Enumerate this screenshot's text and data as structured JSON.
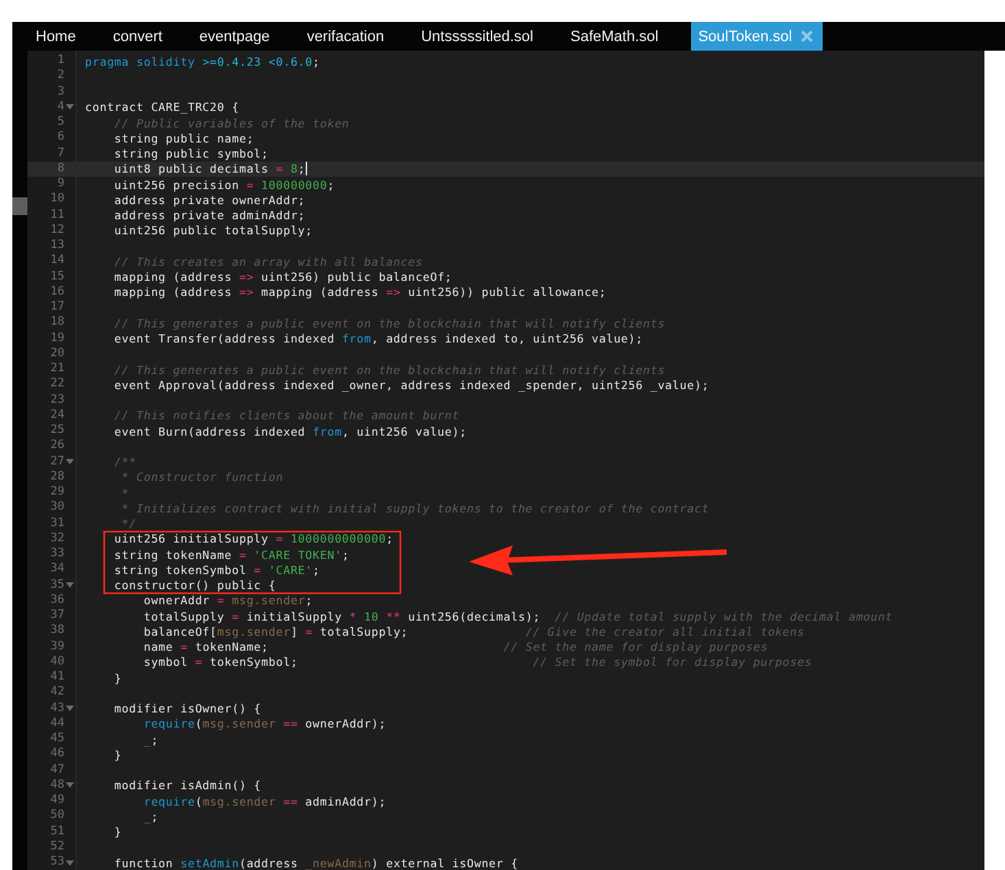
{
  "tabs": [
    {
      "label": "Home",
      "selected": false,
      "closable": false
    },
    {
      "label": "convert",
      "selected": false,
      "closable": false
    },
    {
      "label": "eventpage",
      "selected": false,
      "closable": false
    },
    {
      "label": "verifacation",
      "selected": false,
      "closable": false
    },
    {
      "label": "Untsssssitled.sol",
      "selected": false,
      "closable": false
    },
    {
      "label": "SafeMath.sol",
      "selected": false,
      "closable": false
    },
    {
      "label": "SoulToken.sol",
      "selected": true,
      "closable": true
    }
  ],
  "editor": {
    "lines": [
      {
        "number": "1",
        "active": false,
        "foldable": false,
        "tokens": [
          {
            "kind": "keyword",
            "text": "pragma solidity "
          },
          {
            "kind": "version",
            "text": ">=0.4.23 <0.6.0"
          },
          {
            "kind": "plain",
            "text": ";"
          }
        ]
      },
      {
        "number": "2",
        "active": false,
        "foldable": false
      },
      {
        "number": "3",
        "active": false,
        "foldable": false
      },
      {
        "number": "4",
        "active": false,
        "foldable": true,
        "tokens": [
          {
            "kind": "plain",
            "text": "contract CARE_TRC20 {"
          }
        ]
      },
      {
        "number": "5",
        "active": false,
        "foldable": false,
        "tokens": [
          {
            "kind": "comment",
            "text": "    // Public variables of the token"
          }
        ]
      },
      {
        "number": "6",
        "active": false,
        "foldable": false,
        "tokens": [
          {
            "kind": "plain",
            "text": "    string public name;"
          }
        ]
      },
      {
        "number": "7",
        "active": false,
        "foldable": false,
        "tokens": [
          {
            "kind": "plain",
            "text": "    string public symbol;"
          }
        ]
      },
      {
        "number": "8",
        "active": true,
        "foldable": false,
        "tokens": [
          {
            "kind": "plain",
            "text": "    uint8 public decimals "
          },
          {
            "kind": "operator",
            "text": "="
          },
          {
            "kind": "number",
            "text": " 8"
          },
          {
            "kind": "plain",
            "text": ";"
          }
        ]
      },
      {
        "number": "9",
        "active": false,
        "foldable": false,
        "tokens": [
          {
            "kind": "plain",
            "text": "    uint256 precision "
          },
          {
            "kind": "operator",
            "text": "="
          },
          {
            "kind": "number",
            "text": " 100000000"
          },
          {
            "kind": "plain",
            "text": ";"
          }
        ]
      },
      {
        "number": "10",
        "active": false,
        "foldable": false,
        "tokens": [
          {
            "kind": "plain",
            "text": "    address private ownerAddr;"
          }
        ]
      },
      {
        "number": "11",
        "active": false,
        "foldable": false,
        "tokens": [
          {
            "kind": "plain",
            "text": "    address private adminAddr;"
          }
        ]
      },
      {
        "number": "12",
        "active": false,
        "foldable": false,
        "tokens": [
          {
            "kind": "plain",
            "text": "    uint256 public totalSupply;"
          }
        ]
      },
      {
        "number": "13",
        "active": false,
        "foldable": false
      },
      {
        "number": "14",
        "active": false,
        "foldable": false,
        "tokens": [
          {
            "kind": "comment",
            "text": "    // This creates an array with all balances"
          }
        ]
      },
      {
        "number": "15",
        "active": false,
        "foldable": false,
        "tokens": [
          {
            "kind": "plain",
            "text": "    mapping (address "
          },
          {
            "kind": "operator",
            "text": "=>"
          },
          {
            "kind": "plain",
            "text": " uint256) public balanceOf;"
          }
        ]
      },
      {
        "number": "16",
        "active": false,
        "foldable": false,
        "tokens": [
          {
            "kind": "plain",
            "text": "    mapping (address "
          },
          {
            "kind": "operator",
            "text": "=>"
          },
          {
            "kind": "plain",
            "text": " mapping (address "
          },
          {
            "kind": "operator",
            "text": "=>"
          },
          {
            "kind": "plain",
            "text": " uint256)) public allowance;"
          }
        ]
      },
      {
        "number": "17",
        "active": false,
        "foldable": false
      },
      {
        "number": "18",
        "active": false,
        "foldable": false,
        "tokens": [
          {
            "kind": "comment",
            "text": "    // This generates a public event on the blockchain that will notify clients"
          }
        ]
      },
      {
        "number": "19",
        "active": false,
        "foldable": false,
        "tokens": [
          {
            "kind": "plain",
            "text": "    event Transfer(address indexed "
          },
          {
            "kind": "keyword",
            "text": "from"
          },
          {
            "kind": "plain",
            "text": ", address indexed to, uint256 value);"
          }
        ]
      },
      {
        "number": "20",
        "active": false,
        "foldable": false
      },
      {
        "number": "21",
        "active": false,
        "foldable": false,
        "tokens": [
          {
            "kind": "comment",
            "text": "    // This generates a public event on the blockchain that will notify clients"
          }
        ]
      },
      {
        "number": "22",
        "active": false,
        "foldable": false,
        "tokens": [
          {
            "kind": "plain",
            "text": "    event Approval(address indexed _owner, address indexed _spender, uint256 _value);"
          }
        ]
      },
      {
        "number": "23",
        "active": false,
        "foldable": false
      },
      {
        "number": "24",
        "active": false,
        "foldable": false,
        "tokens": [
          {
            "kind": "comment",
            "text": "    // This notifies clients about the amount burnt"
          }
        ]
      },
      {
        "number": "25",
        "active": false,
        "foldable": false,
        "tokens": [
          {
            "kind": "plain",
            "text": "    event Burn(address indexed "
          },
          {
            "kind": "keyword",
            "text": "from"
          },
          {
            "kind": "plain",
            "text": ", uint256 value);"
          }
        ]
      },
      {
        "number": "26",
        "active": false,
        "foldable": false
      },
      {
        "number": "27",
        "active": false,
        "foldable": true,
        "tokens": [
          {
            "kind": "comment",
            "text": "    /**"
          }
        ]
      },
      {
        "number": "28",
        "active": false,
        "foldable": false,
        "tokens": [
          {
            "kind": "comment",
            "text": "     * Constructor function"
          }
        ]
      },
      {
        "number": "29",
        "active": false,
        "foldable": false,
        "tokens": [
          {
            "kind": "comment",
            "text": "     *"
          }
        ]
      },
      {
        "number": "30",
        "active": false,
        "foldable": false,
        "tokens": [
          {
            "kind": "comment",
            "text": "     * Initializes contract with initial supply tokens to the creator of the contract"
          }
        ]
      },
      {
        "number": "31",
        "active": false,
        "foldable": false,
        "tokens": [
          {
            "kind": "comment",
            "text": "     */"
          }
        ]
      },
      {
        "number": "32",
        "active": false,
        "foldable": false,
        "tokens": [
          {
            "kind": "plain",
            "text": "    uint256 initialSupply "
          },
          {
            "kind": "operator",
            "text": "="
          },
          {
            "kind": "number",
            "text": " 1000000000000"
          },
          {
            "kind": "plain",
            "text": ";"
          }
        ]
      },
      {
        "number": "33",
        "active": false,
        "foldable": false,
        "tokens": [
          {
            "kind": "plain",
            "text": "    string tokenName "
          },
          {
            "kind": "operator",
            "text": "="
          },
          {
            "kind": "string",
            "text": " 'CARE TOKEN'"
          },
          {
            "kind": "plain",
            "text": ";"
          }
        ]
      },
      {
        "number": "34",
        "active": false,
        "foldable": false,
        "tokens": [
          {
            "kind": "plain",
            "text": "    string tokenSymbol "
          },
          {
            "kind": "operator",
            "text": "="
          },
          {
            "kind": "string",
            "text": " 'CARE'"
          },
          {
            "kind": "plain",
            "text": ";"
          }
        ]
      },
      {
        "number": "35",
        "active": false,
        "foldable": true,
        "tokens": [
          {
            "kind": "plain",
            "text": "    constructor() public {"
          }
        ]
      },
      {
        "number": "36",
        "active": false,
        "foldable": false,
        "tokens": [
          {
            "kind": "plain",
            "text": "        ownerAddr "
          },
          {
            "kind": "operator",
            "text": "="
          },
          {
            "kind": "builtin",
            "text": " msg.sender"
          },
          {
            "kind": "plain",
            "text": ";"
          }
        ]
      },
      {
        "number": "37",
        "active": false,
        "foldable": false,
        "tokens": [
          {
            "kind": "plain",
            "text": "        totalSupply "
          },
          {
            "kind": "operator",
            "text": "="
          },
          {
            "kind": "plain",
            "text": " initialSupply "
          },
          {
            "kind": "operator",
            "text": "*"
          },
          {
            "kind": "number",
            "text": " 10 "
          },
          {
            "kind": "operator",
            "text": "**"
          },
          {
            "kind": "plain",
            "text": " uint256(decimals);"
          },
          {
            "kind": "comment",
            "text": "  // Update total supply with the decimal amount"
          }
        ]
      },
      {
        "number": "38",
        "active": false,
        "foldable": false,
        "tokens": [
          {
            "kind": "plain",
            "text": "        balanceOf["
          },
          {
            "kind": "builtin",
            "text": "msg.sender"
          },
          {
            "kind": "plain",
            "text": "] "
          },
          {
            "kind": "operator",
            "text": "="
          },
          {
            "kind": "plain",
            "text": " totalSupply;"
          },
          {
            "kind": "comment",
            "text": "                // Give the creator all initial tokens"
          }
        ]
      },
      {
        "number": "39",
        "active": false,
        "foldable": false,
        "tokens": [
          {
            "kind": "plain",
            "text": "        name "
          },
          {
            "kind": "operator",
            "text": "="
          },
          {
            "kind": "plain",
            "text": " tokenName;"
          },
          {
            "kind": "comment",
            "text": "                                // Set the name for display purposes"
          }
        ]
      },
      {
        "number": "40",
        "active": false,
        "foldable": false,
        "tokens": [
          {
            "kind": "plain",
            "text": "        symbol "
          },
          {
            "kind": "operator",
            "text": "="
          },
          {
            "kind": "plain",
            "text": " tokenSymbol;"
          },
          {
            "kind": "comment",
            "text": "                                // Set the symbol for display purposes"
          }
        ]
      },
      {
        "number": "41",
        "active": false,
        "foldable": false,
        "tokens": [
          {
            "kind": "plain",
            "text": "    }"
          }
        ]
      },
      {
        "number": "42",
        "active": false,
        "foldable": false
      },
      {
        "number": "43",
        "active": false,
        "foldable": true,
        "tokens": [
          {
            "kind": "plain",
            "text": "    modifier isOwner() {"
          }
        ]
      },
      {
        "number": "44",
        "active": false,
        "foldable": false,
        "tokens": [
          {
            "kind": "keyword",
            "text": "        require"
          },
          {
            "kind": "plain",
            "text": "("
          },
          {
            "kind": "builtin",
            "text": "msg.sender"
          },
          {
            "kind": "operator",
            "text": " =="
          },
          {
            "kind": "plain",
            "text": " ownerAddr);"
          }
        ]
      },
      {
        "number": "45",
        "active": false,
        "foldable": false,
        "tokens": [
          {
            "kind": "keyword",
            "text": "        _"
          },
          {
            "kind": "plain",
            "text": ";"
          }
        ]
      },
      {
        "number": "46",
        "active": false,
        "foldable": false,
        "tokens": [
          {
            "kind": "plain",
            "text": "    }"
          }
        ]
      },
      {
        "number": "47",
        "active": false,
        "foldable": false
      },
      {
        "number": "48",
        "active": false,
        "foldable": true,
        "tokens": [
          {
            "kind": "plain",
            "text": "    modifier isAdmin() {"
          }
        ]
      },
      {
        "number": "49",
        "active": false,
        "foldable": false,
        "tokens": [
          {
            "kind": "keyword",
            "text": "        require"
          },
          {
            "kind": "plain",
            "text": "("
          },
          {
            "kind": "builtin",
            "text": "msg.sender"
          },
          {
            "kind": "operator",
            "text": " =="
          },
          {
            "kind": "plain",
            "text": " adminAddr);"
          }
        ]
      },
      {
        "number": "50",
        "active": false,
        "foldable": false,
        "tokens": [
          {
            "kind": "keyword",
            "text": "        _"
          },
          {
            "kind": "plain",
            "text": ";"
          }
        ]
      },
      {
        "number": "51",
        "active": false,
        "foldable": false,
        "tokens": [
          {
            "kind": "plain",
            "text": "    }"
          }
        ]
      },
      {
        "number": "52",
        "active": false,
        "foldable": false
      },
      {
        "number": "53",
        "active": false,
        "foldable": true,
        "tokens": [
          {
            "kind": "plain",
            "text": "    function "
          },
          {
            "kind": "keyword",
            "text": "setAdmin"
          },
          {
            "kind": "plain",
            "text": "(address "
          },
          {
            "kind": "builtin",
            "text": "_newAdmin"
          },
          {
            "kind": "plain",
            "text": ") external isOwner {"
          }
        ]
      }
    ]
  }
}
